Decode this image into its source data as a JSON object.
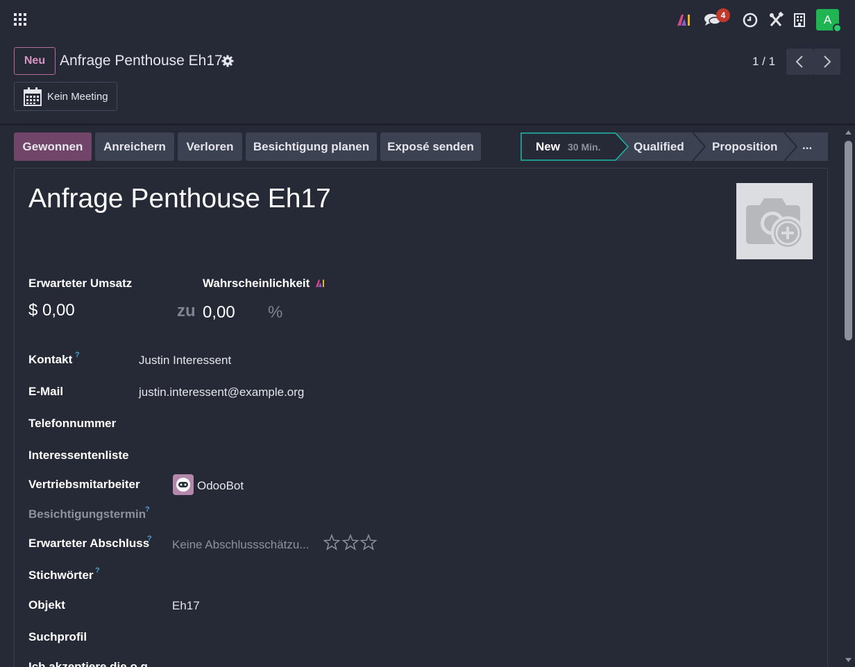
{
  "navbar": {
    "apps_icon": "grid-icon",
    "ai_icon": "ai-sparkle-icon",
    "chat_icon": "chat-icon",
    "chat_count": "4",
    "clock_icon": "clock-icon",
    "tools_icon": "tools-icon",
    "company_icon": "building-icon",
    "user_initial": "A"
  },
  "control": {
    "new_label": "Neu",
    "record_title": "Anfrage Penthouse Eh17",
    "pager": "1 / 1",
    "meeting_label": "Kein Meeting"
  },
  "actions": {
    "won": "Gewonnen",
    "enrich": "Anreichern",
    "lost": "Verloren",
    "schedule": "Besichtigung planen",
    "expose": "Exposé senden"
  },
  "stages": {
    "new": "New",
    "new_duration": "30 Min.",
    "qualified": "Qualified",
    "proposition": "Proposition",
    "more": "..."
  },
  "sheet": {
    "title": "Anfrage Penthouse Eh17",
    "revenue_label": "Erwarteter Umsatz",
    "revenue_value": "$ 0,00",
    "zu": "zu",
    "probability_label": "Wahrscheinlichkeit",
    "probability_value": "0,00",
    "percent": "%",
    "help_mark": "?",
    "contact_label": "Kontakt",
    "contact_value": "Justin Interessent",
    "email_label": "E-Mail",
    "email_value": "justin.interessent@example.org",
    "phone_label": "Telefonnummer",
    "list_label": "Interessentenliste",
    "salesperson_label": "Vertriebsmitarbeiter",
    "salesperson_value": "OdooBot",
    "viewing_label": "Besichtigungstermin",
    "close_label": "Erwarteter Abschluss",
    "close_placeholder": "Keine Abschlussschätzu...",
    "tags_label": "Stichwörter",
    "object_label": "Objekt",
    "object_value": "Eh17",
    "search_profile_label": "Suchprofil",
    "accept_label": "Ich akzeptiere die o.g."
  },
  "colors": {
    "background": "#262a36",
    "primary": "#71456a",
    "accent_teal": "#1ab7a6",
    "badge_red": "#c0392b",
    "avatar_green": "#1fb553"
  }
}
